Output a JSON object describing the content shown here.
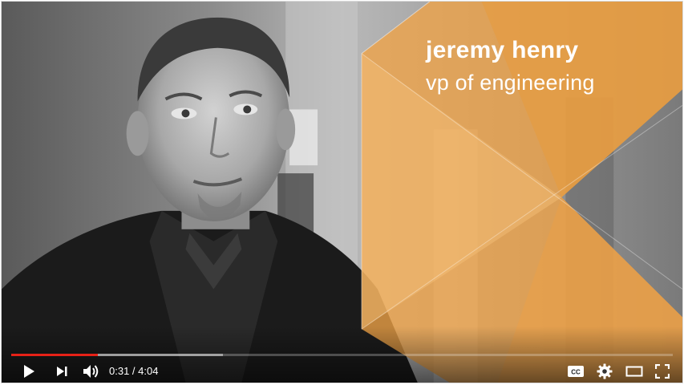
{
  "overlay": {
    "name": "jeremy henry",
    "role": "vp of engineering",
    "accent": "#f0a347"
  },
  "progress": {
    "played_fraction": 0.131,
    "loaded_fraction": 0.32,
    "played_color": "#e62117"
  },
  "controls": {
    "current_time": "0:31",
    "separator": " / ",
    "duration": "4:04",
    "icons": {
      "play": "play-icon",
      "next": "next-icon",
      "volume": "volume-icon",
      "captions": "captions-icon",
      "settings": "gear-icon",
      "theater": "theater-mode-icon",
      "fullscreen": "fullscreen-icon"
    },
    "captions_label": "CC"
  }
}
